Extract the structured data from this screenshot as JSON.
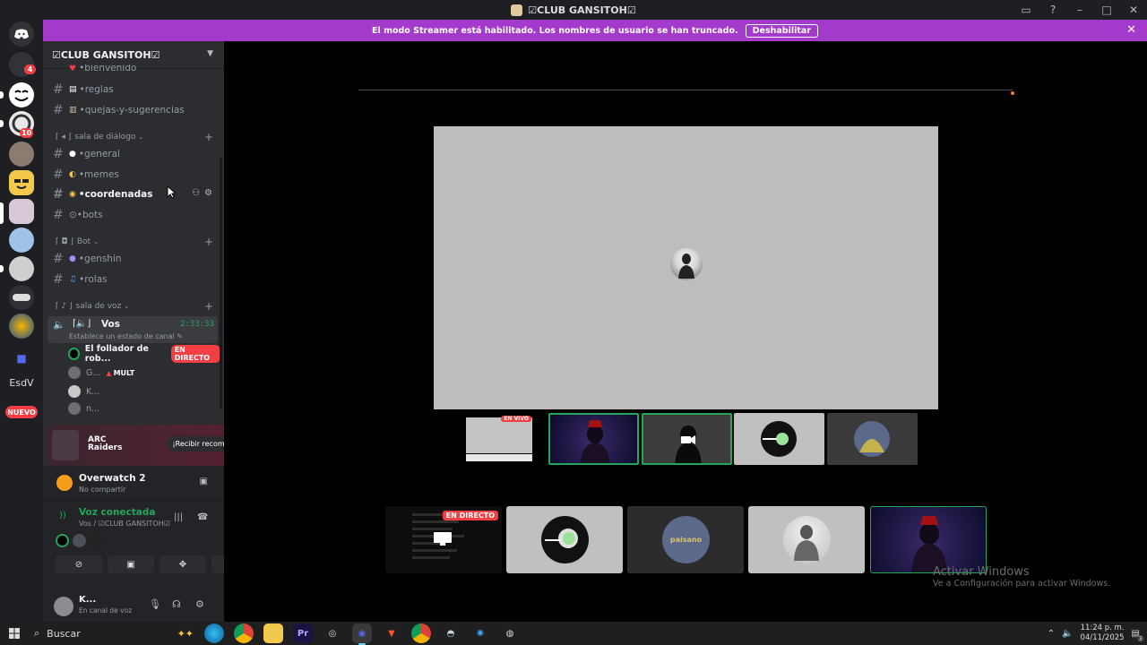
{
  "window": {
    "title": "☑CLUB GANSITOH☑"
  },
  "banner": {
    "text": "El modo Streamer está habilitado. Los nombres de usuario se han truncado.",
    "button": "Deshabilitar"
  },
  "serverbar": {
    "dm_badge": "4",
    "server_badge": "10",
    "esdv": "EsdV",
    "nuevo": "NUEVO"
  },
  "guild": {
    "name": "☑CLUB GANSITOH☑"
  },
  "channels": {
    "bienvenido": "•bienvenido",
    "reglas": "•reglas",
    "quejas": "•quejas-y-sugerencias",
    "cat_dialogo": "sala de diálogo",
    "general": "•general",
    "memes": "•memes",
    "coordenadas": "•coordenadas",
    "bots": "⊙•bots",
    "cat_bot": "Bot",
    "genshin": "•genshin",
    "rolas": "•rolas",
    "cat_voz": "sala de voz"
  },
  "voice_channel": {
    "name": "Vos",
    "time": "2:33:33",
    "status": "Establece un estado de canal",
    "users": [
      {
        "name": "El follador de rob...",
        "badge": "EN DIRECTO"
      },
      {
        "name": "G...",
        "tag": "MULT"
      },
      {
        "name": "K..."
      },
      {
        "name": "n..."
      }
    ]
  },
  "promo": {
    "logo_line1": "ARC",
    "logo_line2": "Raiders",
    "button": "¡Recibir recompensa!"
  },
  "activity": {
    "title": "Overwatch 2",
    "subtitle": "No compartir"
  },
  "rtc": {
    "title": "Voz conectada",
    "subtitle": "Vos / ☑CLUB GANSITOH☑"
  },
  "user": {
    "name": "K...",
    "status": "En canal de voz"
  },
  "stage": {
    "live_label": "EN DIRECTO",
    "thumb_live_label": "EN VIVO",
    "tile_name": "paisano"
  },
  "watermark": {
    "title": "Activar Windows",
    "subtitle": "Ve a Configuración para activar Windows."
  },
  "taskbar": {
    "search": "Buscar",
    "time": "11:24 p. m.",
    "date": "04/11/2025",
    "notif_count": "3"
  },
  "colors": {
    "accent": "#5865f2",
    "live": "#f23f43",
    "connected": "#23a55a",
    "banner": "#a33acb"
  }
}
